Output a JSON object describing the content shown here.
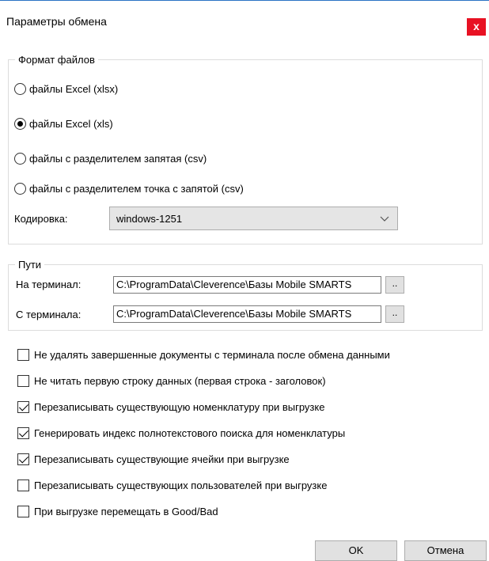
{
  "window": {
    "title": "Параметры обмена",
    "close_label": "x"
  },
  "format_group": {
    "legend": "Формат файлов",
    "options": [
      {
        "label": "файлы Excel (xlsx)",
        "checked": false
      },
      {
        "label": "файлы Excel (xls)",
        "checked": true
      },
      {
        "label": "файлы с разделителем запятая (csv)",
        "checked": false
      },
      {
        "label": "файлы с разделителем точка с запятой (csv)",
        "checked": false
      }
    ],
    "encoding_label": "Кодировка:",
    "encoding_value": "windows-1251"
  },
  "paths_group": {
    "legend": "Пути",
    "to_terminal_label": "На терминал:",
    "to_terminal_value": "C:\\ProgramData\\Cleverence\\Базы Mobile SMARTS",
    "from_terminal_label": "С терминала:",
    "from_terminal_value": "C:\\ProgramData\\Cleverence\\Базы Mobile SMARTS",
    "browse_label": ".."
  },
  "checkboxes": [
    {
      "label": "Не удалять завершенные документы с терминала после обмена данными",
      "checked": false
    },
    {
      "label": "Не читать первую строку данных (первая строка - заголовок)",
      "checked": false
    },
    {
      "label": "Перезаписывать существующую номенклатуру при выгрузке",
      "checked": true
    },
    {
      "label": "Генерировать индекс полнотекстового поиска для номенклатуры",
      "checked": true
    },
    {
      "label": "Перезаписывать существующие ячейки при выгрузке",
      "checked": true
    },
    {
      "label": "Перезаписывать существующих пользователей при выгрузке",
      "checked": false
    },
    {
      "label": "При выгрузке перемещать в Good/Bad",
      "checked": false
    }
  ],
  "buttons": {
    "ok_label": "OK",
    "cancel_label": "Отмена"
  }
}
